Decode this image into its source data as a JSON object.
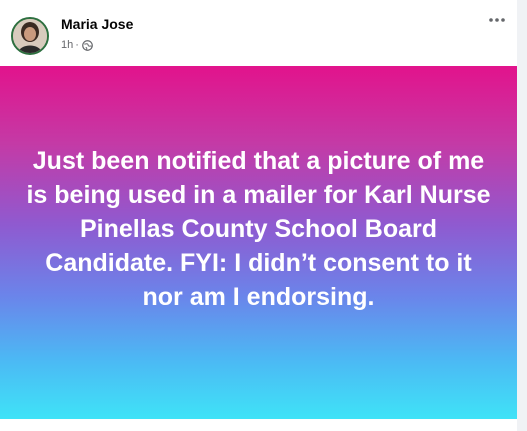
{
  "post": {
    "author": "Maria Jose",
    "timestamp": "1h",
    "separator": "·",
    "audience_icon": "globe-icon",
    "more_icon": "more-options-icon",
    "text": "Just been notified that a picture of me is being used in a mailer for Karl Nurse Pinellas County School Board Candidate. FYI: I didn’t consent to it nor am I endorsing.",
    "background_gradient": [
      "#e2138c",
      "#8f5ad0",
      "#3fe3f7"
    ]
  },
  "colors": {
    "text_primary": "#050505",
    "text_secondary": "#65676b",
    "post_text": "#ffffff"
  }
}
